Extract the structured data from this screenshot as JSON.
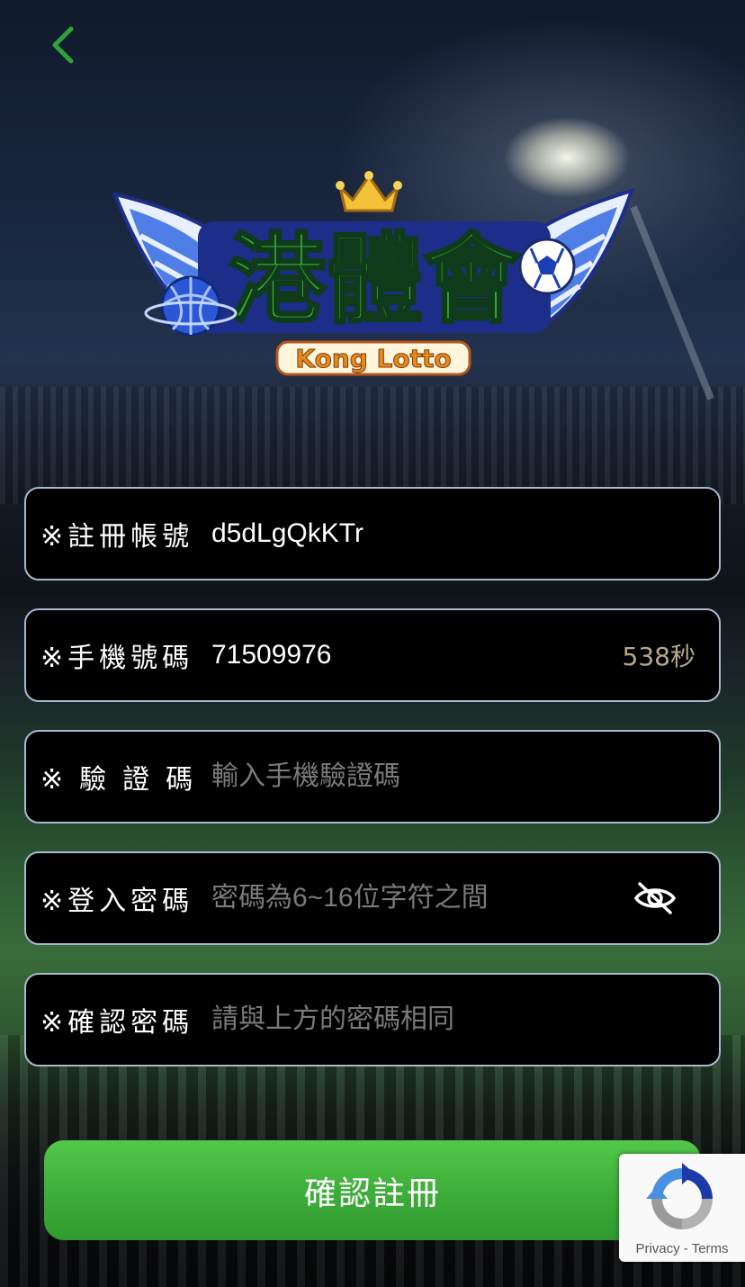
{
  "brand": {
    "name_cn": "港體會",
    "name_en": "Kong Lotto"
  },
  "form": {
    "account": {
      "label": "※註冊帳號",
      "value": "d5dLgQkKTr"
    },
    "phone": {
      "label": "※手機號碼",
      "value": "71509976",
      "countdown": "538秒"
    },
    "code": {
      "label": "※驗證碼",
      "placeholder": "輸入手機驗證碼"
    },
    "password": {
      "label": "※登入密碼",
      "placeholder": "密碼為6~16位字符之間"
    },
    "confirm": {
      "label": "※確認密碼",
      "placeholder": "請與上方的密碼相同"
    },
    "submit_label": "確認註冊"
  },
  "recaptcha": {
    "privacy": "Privacy",
    "separator": " - ",
    "terms": "Terms"
  },
  "icons": {
    "back": "chevron-left-icon",
    "password_toggle": "eye-off-icon",
    "recaptcha": "recaptcha-icon"
  },
  "colors": {
    "accent_green": "#2fa33a",
    "field_border": "#a9b8cf",
    "countdown": "#b8a889",
    "placeholder": "#7a7a7a"
  }
}
